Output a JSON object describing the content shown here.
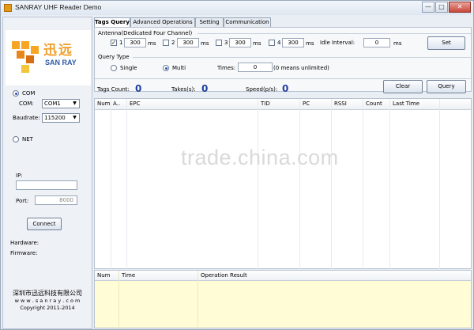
{
  "window": {
    "title": "SANRAY UHF Reader Demo",
    "btn_min": "—",
    "btn_max": "□",
    "btn_close": "✕"
  },
  "logo": {
    "cn": "迅远",
    "en": "SAN RAY"
  },
  "connection": {
    "com_label": "COM",
    "com_field_label": "COM:",
    "com_value": "COM1",
    "baud_label": "Baudrate:",
    "baud_value": "115200",
    "net_label": "NET",
    "ip_label": "IP:",
    "ip_value": "",
    "port_label": "Port:",
    "port_value": "8000",
    "connect_label": "Connect",
    "hardware_label": "Hardware:",
    "firmware_label": "Firmware:"
  },
  "company": {
    "name_cn": "深圳市迅远科技有限公司",
    "url": "w w w . s a n r a y . c o m",
    "copyright": "Copyright 2011-2014"
  },
  "tabs": [
    "Tags Query",
    "Advanced Operations",
    "Setting",
    "Communication"
  ],
  "antenna": {
    "group_label": "Antenna(Dedicated Four Channel)",
    "channels": [
      {
        "num": "1",
        "value": "300",
        "unit": "ms",
        "checked": true
      },
      {
        "num": "2",
        "value": "300",
        "unit": "ms",
        "checked": false
      },
      {
        "num": "3",
        "value": "300",
        "unit": "ms",
        "checked": false
      },
      {
        "num": "4",
        "value": "300",
        "unit": "ms",
        "checked": false
      }
    ],
    "idle_label": "Idle Interval:",
    "idle_value": "0",
    "idle_unit": "ms",
    "set_label": "Set"
  },
  "query_type": {
    "group_label": "Query Type",
    "single_label": "Single",
    "multi_label": "Multi",
    "times_label": "Times:",
    "times_value": "0",
    "times_note": "(0 means unlimited)"
  },
  "stats": {
    "tags_count_label": "Tags Count:",
    "tags_count_value": "0",
    "takes_label": "Takes(s):",
    "takes_value": "0",
    "speed_label": "Speed(p/s):",
    "speed_value": "0",
    "clear_label": "Clear",
    "query_label": "Query"
  },
  "table": {
    "columns": [
      "Num",
      "A..",
      "EPC",
      "TID",
      "PC",
      "RSSI",
      "Count",
      "Last Time"
    ]
  },
  "log": {
    "columns": [
      "Num",
      "Time",
      "Operation Result"
    ]
  },
  "watermark": "trade.china.com"
}
